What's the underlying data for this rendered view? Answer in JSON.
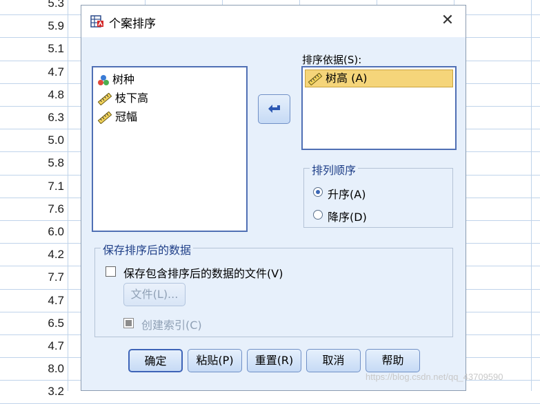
{
  "spreadsheet": {
    "values": [
      "5.3",
      "5.9",
      "5.1",
      "4.7",
      "4.8",
      "6.3",
      "5.0",
      "5.8",
      "7.1",
      "7.6",
      "6.0",
      "4.2",
      "7.7",
      "4.7",
      "6.5",
      "4.7",
      "8.0",
      "3.2"
    ]
  },
  "dialog": {
    "title": "个案排序",
    "close_symbol": "✕",
    "variables": [
      {
        "label": "树种",
        "icon": "nominal-variable-icon"
      },
      {
        "label": "枝下高",
        "icon": "scale-variable-icon"
      },
      {
        "label": "冠幅",
        "icon": "scale-variable-icon"
      }
    ],
    "sort_by_label": "排序依据(S):",
    "sort_by_items": [
      {
        "label": "树高 (A)",
        "icon": "scale-variable-icon"
      }
    ],
    "order_group": {
      "title": "排列顺序",
      "ascending": "升序(A)",
      "descending": "降序(D)",
      "selected": "ascending"
    },
    "save_group": {
      "title": "保存排序后的数据",
      "save_checkbox_label": "保存包含排序后的数据的文件(V)",
      "file_button": "文件(L)...",
      "index_checkbox_label": "创建索引(C)"
    },
    "buttons": {
      "ok": "确定",
      "paste": "粘贴(P)",
      "reset": "重置(R)",
      "cancel": "取消",
      "help": "帮助"
    },
    "colors": {
      "accent": "#3d63b7",
      "selected_item": "#f5d57a",
      "dialog_bg": "#e7f0fb"
    }
  },
  "watermark": "https://blog.csdn.net/qq_43709590"
}
